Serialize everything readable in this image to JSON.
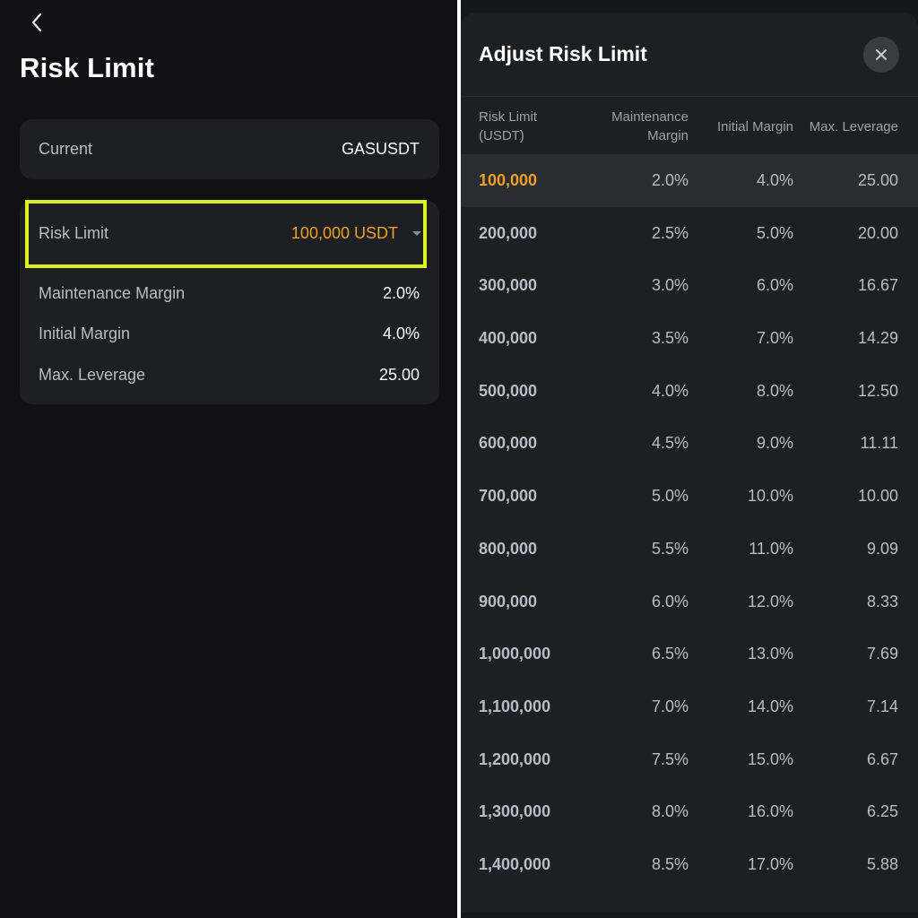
{
  "left": {
    "title": "Risk Limit",
    "current": {
      "label": "Current",
      "value": "GASUSDT"
    },
    "risk_limit": {
      "label": "Risk Limit",
      "value": "100,000 USDT"
    },
    "maintenance_margin": {
      "label": "Maintenance Margin",
      "value": "2.0%"
    },
    "initial_margin": {
      "label": "Initial Margin",
      "value": "4.0%"
    },
    "max_leverage": {
      "label": "Max. Leverage",
      "value": "25.00"
    }
  },
  "sheet": {
    "title": "Adjust Risk Limit",
    "headers": {
      "risk_limit_line1": "Risk Limit",
      "risk_limit_line2": "(USDT)",
      "maintenance_line1": "Maintenance",
      "maintenance_line2": "Margin",
      "initial_margin": "Initial Margin",
      "max_leverage": "Max. Leverage"
    },
    "rows": [
      {
        "limit": "100,000",
        "mm": "2.0%",
        "im": "4.0%",
        "lev": "25.00",
        "selected": true
      },
      {
        "limit": "200,000",
        "mm": "2.5%",
        "im": "5.0%",
        "lev": "20.00"
      },
      {
        "limit": "300,000",
        "mm": "3.0%",
        "im": "6.0%",
        "lev": "16.67"
      },
      {
        "limit": "400,000",
        "mm": "3.5%",
        "im": "7.0%",
        "lev": "14.29"
      },
      {
        "limit": "500,000",
        "mm": "4.0%",
        "im": "8.0%",
        "lev": "12.50"
      },
      {
        "limit": "600,000",
        "mm": "4.5%",
        "im": "9.0%",
        "lev": "11.11"
      },
      {
        "limit": "700,000",
        "mm": "5.0%",
        "im": "10.0%",
        "lev": "10.00"
      },
      {
        "limit": "800,000",
        "mm": "5.5%",
        "im": "11.0%",
        "lev": "9.09"
      },
      {
        "limit": "900,000",
        "mm": "6.0%",
        "im": "12.0%",
        "lev": "8.33"
      },
      {
        "limit": "1,000,000",
        "mm": "6.5%",
        "im": "13.0%",
        "lev": "7.69"
      },
      {
        "limit": "1,100,000",
        "mm": "7.0%",
        "im": "14.0%",
        "lev": "7.14"
      },
      {
        "limit": "1,200,000",
        "mm": "7.5%",
        "im": "15.0%",
        "lev": "6.67"
      },
      {
        "limit": "1,300,000",
        "mm": "8.0%",
        "im": "16.0%",
        "lev": "6.25"
      },
      {
        "limit": "1,400,000",
        "mm": "8.5%",
        "im": "17.0%",
        "lev": "5.88"
      }
    ]
  },
  "colors": {
    "accent": "#f0a020",
    "highlight": "#dcf31f",
    "background": "#111115",
    "card": "#1e1f23"
  },
  "icons": {
    "back": "chevron-left-icon",
    "dropdown": "caret-down-icon",
    "close": "close-icon"
  }
}
